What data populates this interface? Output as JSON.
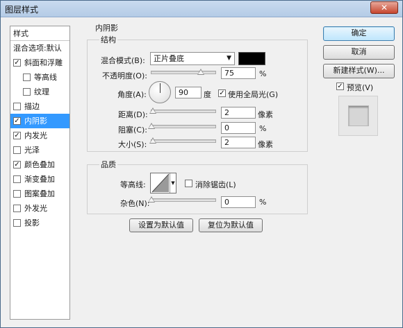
{
  "window": {
    "title": "图层样式",
    "close_glyph": "✕"
  },
  "sidebar": {
    "items": [
      {
        "label": "样式",
        "checkbox": false,
        "checked": false,
        "selected": false
      },
      {
        "label": "混合选项:默认",
        "checkbox": false,
        "checked": false,
        "selected": false
      },
      {
        "label": "斜面和浮雕",
        "checkbox": true,
        "checked": true,
        "selected": false
      },
      {
        "label": "等高线",
        "checkbox": true,
        "checked": false,
        "selected": false
      },
      {
        "label": "纹理",
        "checkbox": true,
        "checked": false,
        "selected": false
      },
      {
        "label": "描边",
        "checkbox": true,
        "checked": false,
        "selected": false
      },
      {
        "label": "内阴影",
        "checkbox": true,
        "checked": true,
        "selected": true
      },
      {
        "label": "内发光",
        "checkbox": true,
        "checked": true,
        "selected": false
      },
      {
        "label": "光泽",
        "checkbox": true,
        "checked": false,
        "selected": false
      },
      {
        "label": "颜色叠加",
        "checkbox": true,
        "checked": true,
        "selected": false
      },
      {
        "label": "渐变叠加",
        "checkbox": true,
        "checked": false,
        "selected": false
      },
      {
        "label": "图案叠加",
        "checkbox": true,
        "checked": false,
        "selected": false
      },
      {
        "label": "外发光",
        "checkbox": true,
        "checked": false,
        "selected": false
      },
      {
        "label": "投影",
        "checkbox": true,
        "checked": false,
        "selected": false
      }
    ],
    "check_glyph": "✓"
  },
  "inner_shadow": {
    "section_title": "内阴影",
    "structure": {
      "title": "结构",
      "blend_mode_label": "混合模式(B):",
      "blend_mode_value": "正片叠底",
      "blend_color": "#000000",
      "opacity_label": "不透明度(O):",
      "opacity_value": "75",
      "opacity_unit": "%",
      "angle_label": "角度(A):",
      "angle_value": "90",
      "angle_unit": "度",
      "global_light_label": "使用全局光(G)",
      "global_light_checked": true,
      "distance_label": "距离(D):",
      "distance_value": "2",
      "distance_unit": "像素",
      "choke_label": "阻塞(C):",
      "choke_value": "0",
      "choke_unit": "%",
      "size_label": "大小(S):",
      "size_value": "2",
      "size_unit": "像素"
    },
    "quality": {
      "title": "品质",
      "contour_label": "等高线:",
      "anti_alias_label": "消除锯齿(L)",
      "anti_alias_checked": false,
      "noise_label": "杂色(N):",
      "noise_value": "0",
      "noise_unit": "%"
    },
    "buttons": {
      "make_default": "设置为默认值",
      "reset_default": "复位为默认值"
    }
  },
  "right_panel": {
    "ok": "确定",
    "cancel": "取消",
    "new_style": "新建样式(W)...",
    "preview_label": "预览(V)",
    "preview_checked": true
  }
}
